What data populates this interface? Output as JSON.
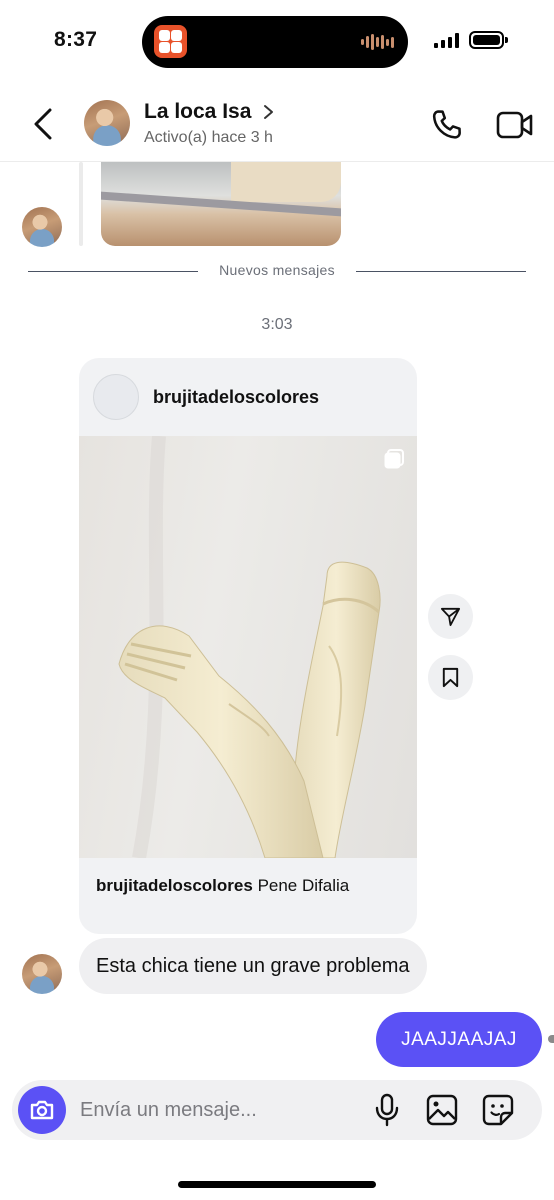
{
  "status_bar": {
    "time": "8:37"
  },
  "header": {
    "contact_name": "La loca Isa",
    "contact_status": "Activo(a) hace 3 h"
  },
  "chat": {
    "divider_label": "Nuevos mensajes",
    "timestamp": "3:03",
    "shared_post": {
      "username": "brujitadeloscolores",
      "caption_user": "brujitadeloscolores",
      "caption_text": "Pene Difalia"
    },
    "incoming_message": "Esta chica tiene un grave problema",
    "outgoing_message": "JAAJJAAJAJ"
  },
  "composer": {
    "placeholder": "Envía un mensaje..."
  },
  "colors": {
    "accent": "#5b51f5",
    "incoming_bubble": "#efeff1",
    "post_card": "#f1f2f4"
  }
}
